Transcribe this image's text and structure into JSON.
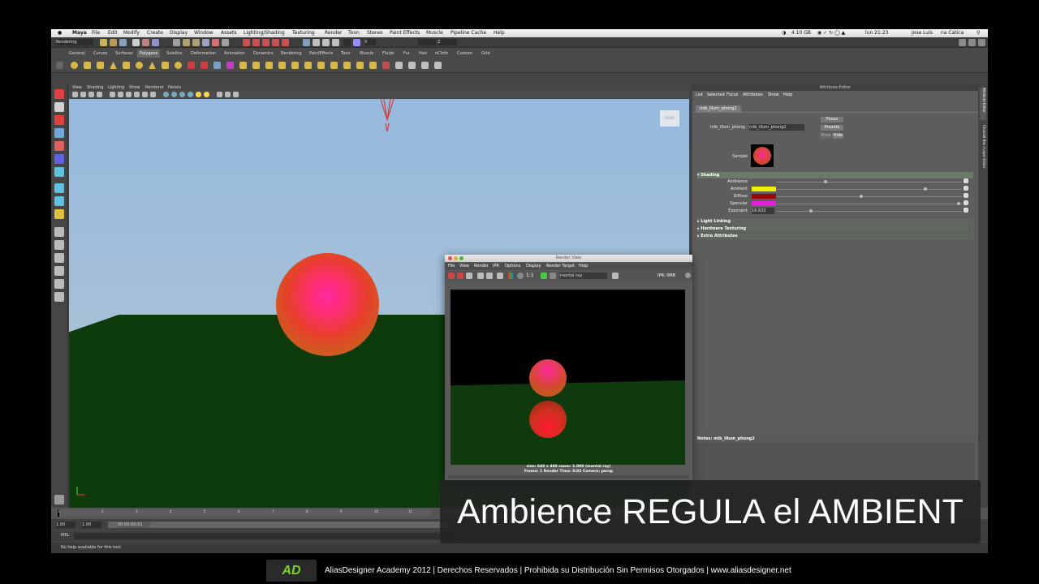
{
  "menubar": {
    "items": [
      "Maya",
      "File",
      "Edit",
      "Modify",
      "Create",
      "Display",
      "Window",
      "Assets",
      "Lighting/Shading",
      "Texturing",
      "Render",
      "Toon",
      "Stereo",
      "Paint Effects",
      "Muscle",
      "Pipeline Cache",
      "Help"
    ],
    "status": {
      "wifi": "4.10 GB",
      "clock": "lun 21:23",
      "user": "Jose Luis",
      "other": "na Catica"
    }
  },
  "status_line": {
    "mode": "Rendering",
    "z_field": "Z"
  },
  "shelf": {
    "tabs": [
      "General",
      "Curves",
      "Surfaces",
      "Polygons",
      "Subdivs",
      "Deformation",
      "Animation",
      "Dynamics",
      "Rendering",
      "PaintEffects",
      "Toon",
      "Muscle",
      "Fluids",
      "Fur",
      "Hair",
      "nCloth",
      "Custom",
      "Grid"
    ],
    "active": "Polygons"
  },
  "viewport": {
    "menu": [
      "View",
      "Shading",
      "Lighting",
      "Show",
      "Renderer",
      "Panels"
    ],
    "view_cube": "FRONT",
    "colors": {
      "sky_top": "#96b9dd",
      "ground": "#0e3b0c"
    }
  },
  "attribute_editor": {
    "title": "Attribute Editor",
    "menu": [
      "List",
      "Selected",
      "Focus",
      "Attributes",
      "Show",
      "Help"
    ],
    "tab": "mib_illum_phong2",
    "node_label": "mib_illum_phong:",
    "node_value": "mib_illum_phong2",
    "buttons": {
      "focus": "Focus",
      "presets": "Presets",
      "show": "Show",
      "hide": "Hide"
    },
    "sample_label": "Sample",
    "shading_section": "Shading",
    "attrs": [
      {
        "label": "Ambience",
        "color": null,
        "value": ""
      },
      {
        "label": "Ambient",
        "color": "#f0f000",
        "value": ""
      },
      {
        "label": "Diffuse",
        "color": "#9a0808",
        "value": ""
      },
      {
        "label": "Specular",
        "color": "#e020d8",
        "value": ""
      },
      {
        "label": "Exponent",
        "color": null,
        "value": "16.632"
      }
    ],
    "collapsed_sections": [
      "Light Linking",
      "Hardware Texturing",
      "Extra Attributes"
    ],
    "notes": "Notes:  mib_illum_phong2",
    "side_tabs": [
      "Attribute Editor",
      "Channel Box / Layer Editor"
    ]
  },
  "render_view": {
    "title": "Render View",
    "menu": [
      "File",
      "View",
      "Render",
      "IPR",
      "Options",
      "Display",
      "Render Target",
      "Help"
    ],
    "ratio": "1:1",
    "renderer": "mental ray",
    "ipr": "IPR: 0MB",
    "info_line1": "size: 640 x 480  zoom: 1.000     (mental ray)",
    "info_line2": "Frame: 1      Render Time: 0:02      Camera: persp"
  },
  "timeline": {
    "start": "1.00",
    "end": "1.00",
    "time": "00:00:00:01",
    "frame_labels": [
      "1",
      "2",
      "3",
      "4",
      "5",
      "6",
      "7",
      "8",
      "9",
      "10",
      "11"
    ]
  },
  "mel": {
    "label": "MEL"
  },
  "help_line": "No help available for this tool",
  "caption": "Ambience REGULA el AMBIENT",
  "footer": {
    "logo": "AD",
    "text": "AliasDesigner Academy 2012 | Derechos Reservados | Prohibida su Distribución Sin Permisos Otorgados | www.aliasdesigner.net"
  }
}
